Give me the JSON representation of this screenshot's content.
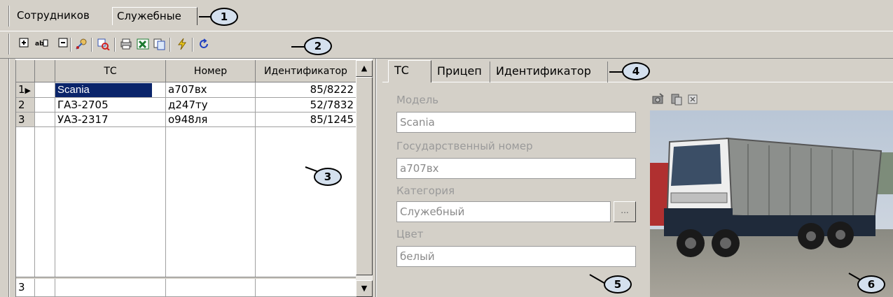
{
  "top_tabs": [
    {
      "label": "Сотрудников"
    },
    {
      "label": "Служебные"
    }
  ],
  "callouts": [
    "1",
    "2",
    "3",
    "4",
    "5",
    "6"
  ],
  "toolbar": {
    "icons": [
      "add-icon",
      "rename-icon",
      "remove-icon",
      "assign-icon",
      "filter-icon",
      "print-icon",
      "excel-icon",
      "copy-icon",
      "lightning-icon",
      "refresh-icon"
    ]
  },
  "grid": {
    "columns": [
      "ТС",
      "Номер",
      "Идентификатор"
    ],
    "rows": [
      {
        "num": "1",
        "tc": "Scania",
        "number": "а707вх",
        "id": "85/8222"
      },
      {
        "num": "2",
        "tc": "ГАЗ-2705",
        "number": "д247ту",
        "id": "52/7832"
      },
      {
        "num": "3",
        "tc": "УАЗ-2317",
        "number": "о948ля",
        "id": "85/1245"
      }
    ],
    "footer_count": "3"
  },
  "right_tabs": [
    {
      "label": "ТС"
    },
    {
      "label": "Прицеп"
    },
    {
      "label": "Идентификатор"
    }
  ],
  "form": {
    "model_label": "Модель",
    "model_value": "Scania",
    "plate_label": "Государственный номер",
    "plate_value": "а707вх",
    "category_label": "Категория",
    "category_value": "Служебный",
    "category_button": "...",
    "color_label": "Цвет",
    "color_value": "белый"
  },
  "photo": {
    "toolbar_icons": [
      "load-photo-icon",
      "paste-photo-icon",
      "delete-photo-icon"
    ]
  }
}
